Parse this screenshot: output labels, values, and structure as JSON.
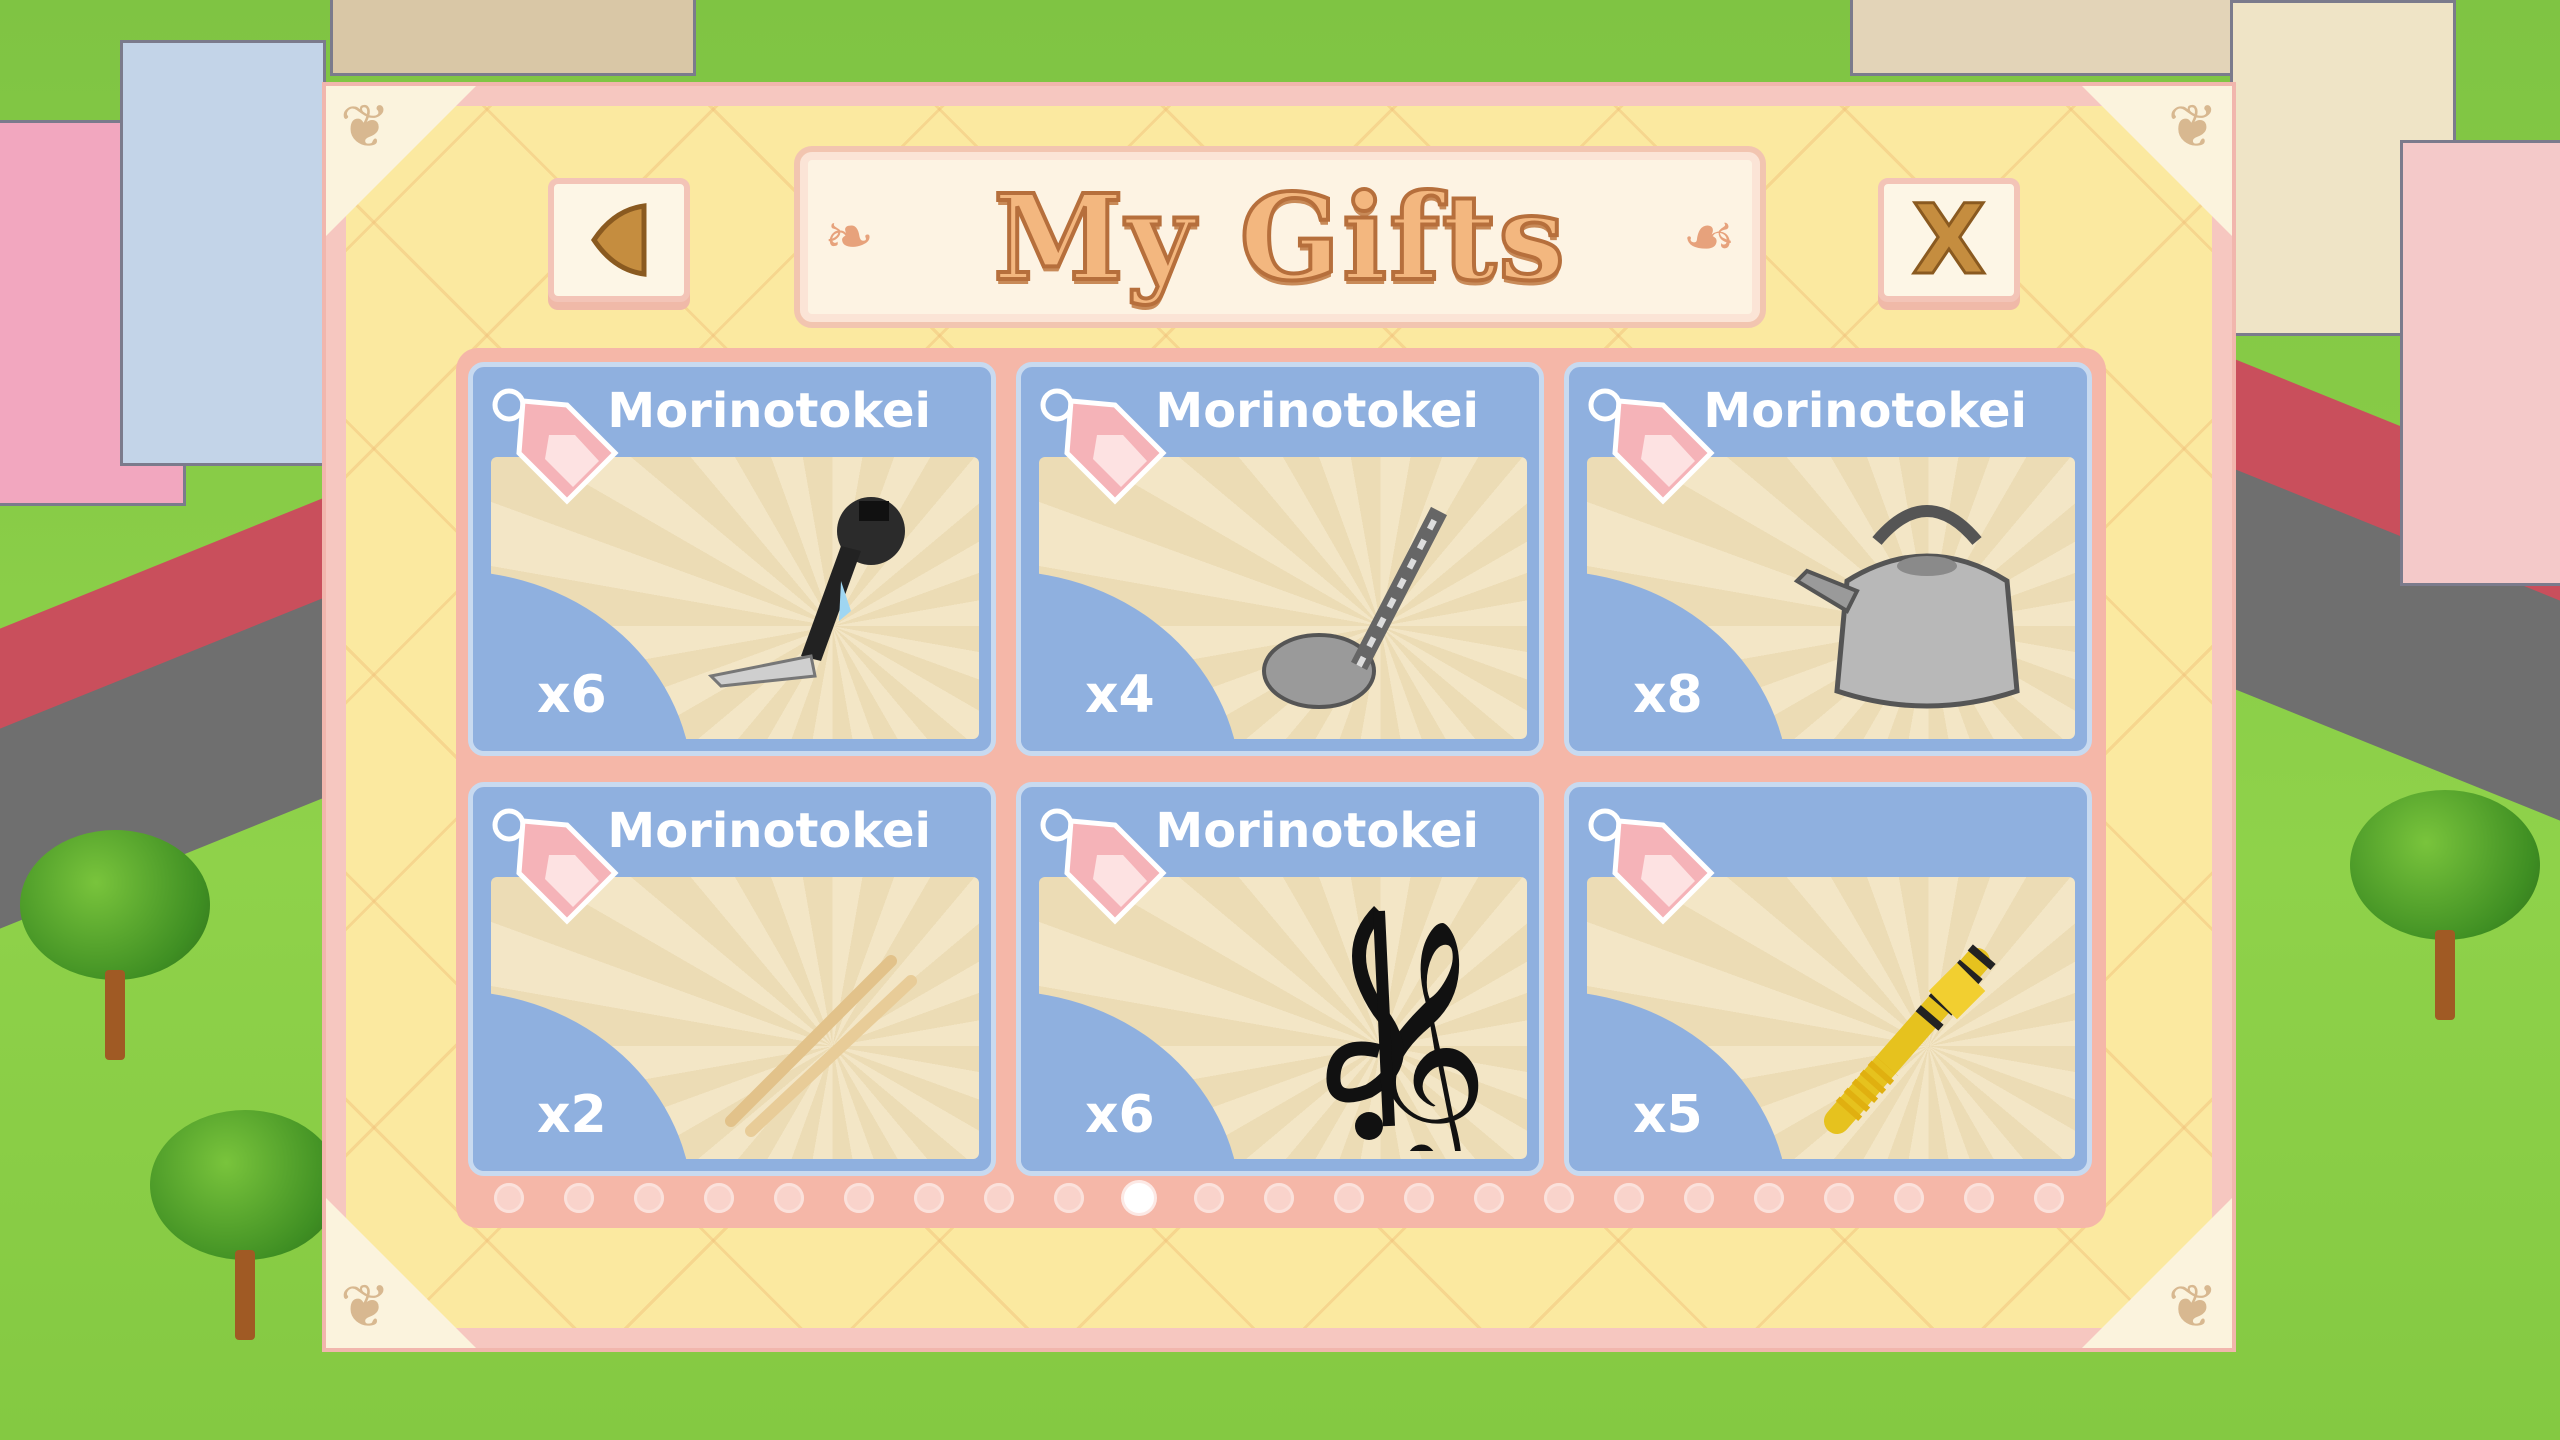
{
  "dialog": {
    "title": "My Gifts",
    "back_icon": "triangle-left-icon",
    "close_label": "X"
  },
  "gifts": [
    {
      "sender": "Morinotokei",
      "quantity": "x6",
      "icon": "hand-crank-icon"
    },
    {
      "sender": "Morinotokei",
      "quantity": "x4",
      "icon": "music-note-spring-icon"
    },
    {
      "sender": "Morinotokei",
      "quantity": "x8",
      "icon": "kettle-icon"
    },
    {
      "sender": "Morinotokei",
      "quantity": "x2",
      "icon": "drumsticks-icon"
    },
    {
      "sender": "Morinotokei",
      "quantity": "x6",
      "icon": "treble-clef-icon"
    },
    {
      "sender": "",
      "quantity": "x5",
      "icon": "gold-screw-icon"
    }
  ],
  "pagination": {
    "total": 23,
    "current": 10
  },
  "colors": {
    "card_blue": "#8fb0df",
    "panel_pink": "#f5b7a8",
    "dialog_yellow": "#fbe9a0",
    "title_orange": "#f3b77f"
  }
}
